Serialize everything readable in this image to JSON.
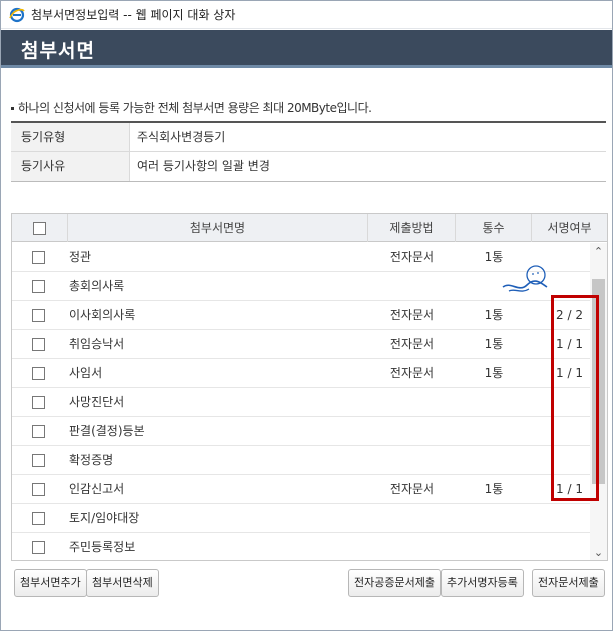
{
  "window": {
    "title": "첨부서면정보입력 -- 웹 페이지 대화 상자"
  },
  "header": {
    "title": "첨부서면"
  },
  "notice": "하나의 신청서에 등록 가능한 전체 첨부서면 용량은 최대 20MByte입니다.",
  "info": [
    {
      "label": "등기유형",
      "value": "주식회사변경등기"
    },
    {
      "label": "등기사유",
      "value": "여러 등기사항의 일괄 변경"
    }
  ],
  "grid": {
    "columns": {
      "name": "첨부서면명",
      "method": "제출방법",
      "count": "통수",
      "sign": "서명여부"
    },
    "rows": [
      {
        "name": "정관",
        "method": "전자문서",
        "count": "1통",
        "sign": ""
      },
      {
        "name": "총회의사록",
        "method": "",
        "count": "",
        "sign": ""
      },
      {
        "name": "이사회의사록",
        "method": "전자문서",
        "count": "1통",
        "sign": "2 / 2"
      },
      {
        "name": "취임승낙서",
        "method": "전자문서",
        "count": "1통",
        "sign": "1 / 1"
      },
      {
        "name": "사임서",
        "method": "전자문서",
        "count": "1통",
        "sign": "1 / 1"
      },
      {
        "name": "사망진단서",
        "method": "",
        "count": "",
        "sign": ""
      },
      {
        "name": "판결(결정)등본",
        "method": "",
        "count": "",
        "sign": ""
      },
      {
        "name": "확정증명",
        "method": "",
        "count": "",
        "sign": ""
      },
      {
        "name": "인감신고서",
        "method": "전자문서",
        "count": "1통",
        "sign": "1 / 1"
      },
      {
        "name": "토지/임야대장",
        "method": "",
        "count": "",
        "sign": ""
      },
      {
        "name": "주민등록정보",
        "method": "",
        "count": "",
        "sign": ""
      }
    ]
  },
  "buttons": {
    "add_attachment": "첨부서면추가",
    "delete_attachment": "첨부서면삭제",
    "notarized_submit": "전자공증문서제출",
    "add_signer": "추가서명자등록",
    "e_doc_submit": "전자문서제출"
  },
  "colors": {
    "header_bg": "#3b4a5d",
    "highlight": "#c00000"
  }
}
